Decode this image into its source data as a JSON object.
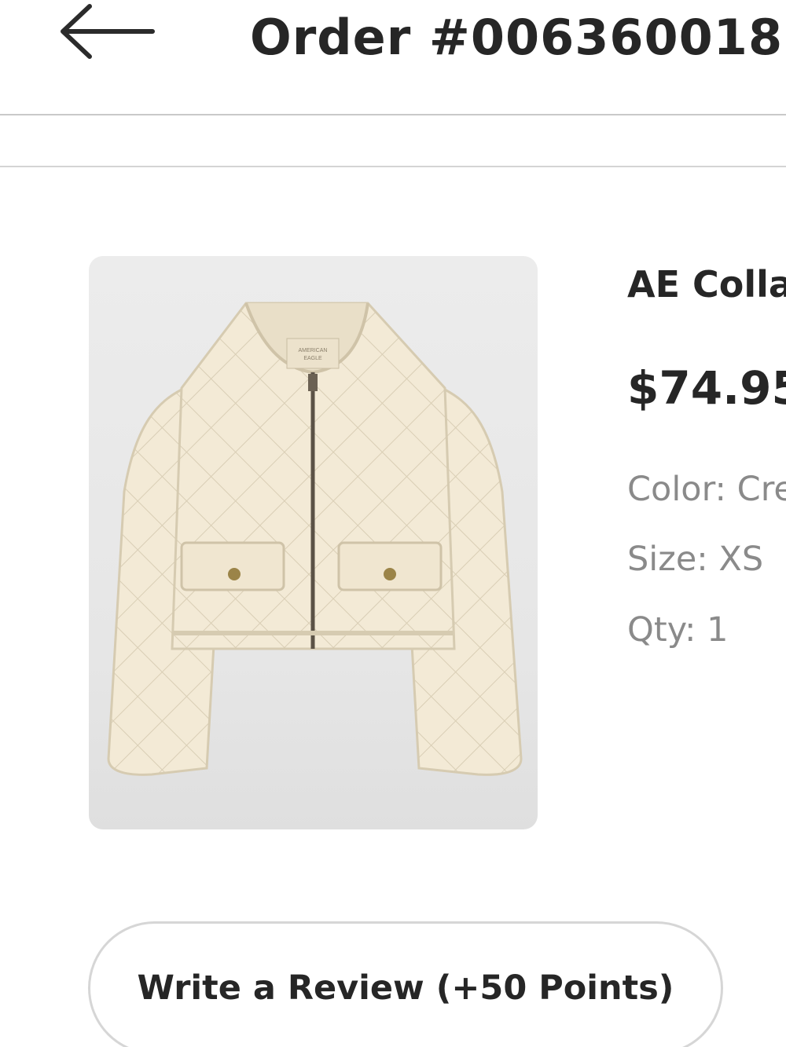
{
  "header": {
    "back_icon": "arrow-left-icon",
    "title": "Order #006360018"
  },
  "product": {
    "image_icon": "quilted-jacket-image",
    "name": "AE Collarless Quilted Jacket",
    "price": "$74.95",
    "color": "Color: Cream",
    "size": "Size: XS",
    "qty": "Qty: 1"
  },
  "actions": {
    "review_label": "Write a Review (+50 Points)"
  },
  "colors": {
    "text": "#262626",
    "muted": "#8a8a8a",
    "border": "#d6d6d6",
    "jacket": "#f3ead6"
  }
}
